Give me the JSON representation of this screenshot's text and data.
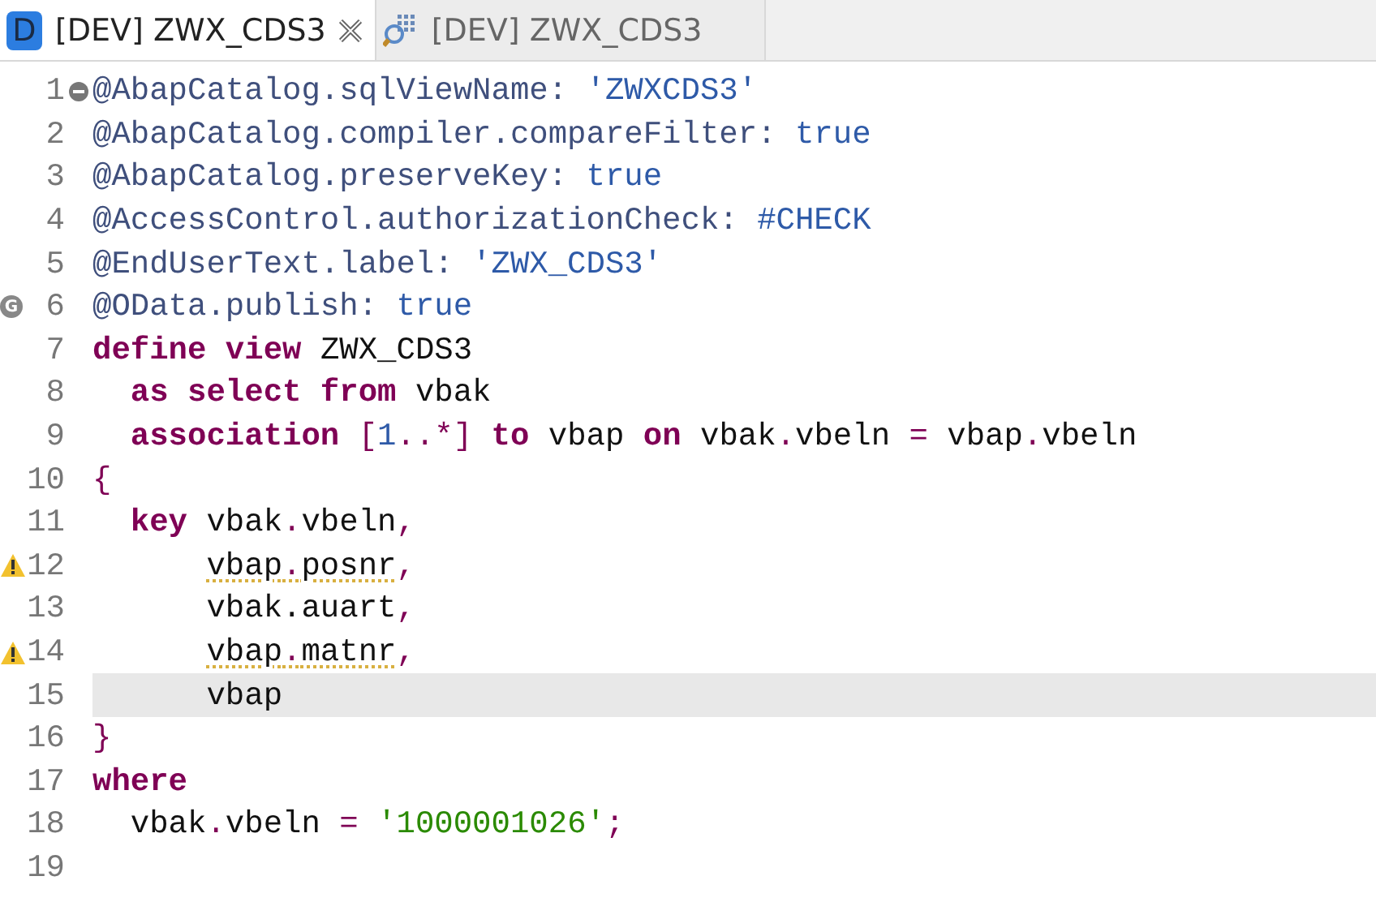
{
  "tabs": [
    {
      "label": "[DEV] ZWX_CDS3",
      "selected": true,
      "icon": {
        "kind": "letter",
        "text": "D"
      }
    },
    {
      "label": "[DEV] ZWX_CDS3",
      "selected": false,
      "icon": {
        "kind": "search"
      }
    }
  ],
  "lines": [
    {
      "number": "1",
      "marker": {
        "kind": "fold"
      },
      "tokens": [
        {
          "kind": "anno",
          "text": "@AbapCatalog.sqlViewName: "
        },
        {
          "kind": "string",
          "text": "'ZWXCDS3'"
        }
      ]
    },
    {
      "number": "2",
      "tokens": [
        {
          "kind": "anno",
          "text": "@AbapCatalog.compiler.compareFilter: "
        },
        {
          "kind": "string",
          "text": "true"
        }
      ]
    },
    {
      "number": "3",
      "tokens": [
        {
          "kind": "anno",
          "text": "@AbapCatalog.preserveKey: "
        },
        {
          "kind": "string",
          "text": "true"
        }
      ]
    },
    {
      "number": "4",
      "tokens": [
        {
          "kind": "anno",
          "text": "@AccessControl.authorizationCheck: "
        },
        {
          "kind": "string",
          "text": "#CHECK"
        }
      ]
    },
    {
      "number": "5",
      "tokens": [
        {
          "kind": "anno",
          "text": "@EndUserText.label: "
        },
        {
          "kind": "string",
          "text": "'ZWX_CDS3'"
        }
      ]
    },
    {
      "number": "6",
      "marker": {
        "kind": "generated",
        "text": "G"
      },
      "tokens": [
        {
          "kind": "anno",
          "text": "@OData.publish: "
        },
        {
          "kind": "string",
          "text": "true"
        }
      ]
    },
    {
      "number": "7",
      "tokens": [
        {
          "kind": "keyword",
          "text": "define view"
        },
        {
          "kind": "plain",
          "text": " ZWX_CDS3"
        }
      ]
    },
    {
      "number": "8",
      "tokens": [
        {
          "kind": "keyword",
          "text": "  as select from"
        },
        {
          "kind": "plain",
          "text": " vbak"
        }
      ]
    },
    {
      "number": "9",
      "tokens": [
        {
          "kind": "keyword",
          "text": "  association"
        },
        {
          "kind": "punct",
          "text": " ["
        },
        {
          "kind": "number",
          "text": "1"
        },
        {
          "kind": "punct",
          "text": "..*]"
        },
        {
          "kind": "keyword",
          "text": " to"
        },
        {
          "kind": "plain",
          "text": " vbap "
        },
        {
          "kind": "keyword",
          "text": "on"
        },
        {
          "kind": "plain",
          "text": " vbak"
        },
        {
          "kind": "punct",
          "text": "."
        },
        {
          "kind": "plain",
          "text": "vbeln "
        },
        {
          "kind": "punct",
          "text": "="
        },
        {
          "kind": "plain",
          "text": " vbap"
        },
        {
          "kind": "punct",
          "text": "."
        },
        {
          "kind": "plain",
          "text": "vbeln"
        }
      ]
    },
    {
      "number": "10",
      "tokens": [
        {
          "kind": "punct",
          "text": "{"
        }
      ]
    },
    {
      "number": "11",
      "tokens": [
        {
          "kind": "keyword",
          "text": "  key"
        },
        {
          "kind": "plain",
          "text": " vbak"
        },
        {
          "kind": "punct",
          "text": "."
        },
        {
          "kind": "plain",
          "text": "vbeln"
        },
        {
          "kind": "punct",
          "text": ","
        }
      ]
    },
    {
      "number": "12",
      "marker": {
        "kind": "warning"
      },
      "tokens": [
        {
          "kind": "plain",
          "text": "      vbap",
          "warn": true
        },
        {
          "kind": "punct",
          "text": ".",
          "warn": true
        },
        {
          "kind": "plain",
          "text": "posnr",
          "warn": true
        },
        {
          "kind": "punct",
          "text": ","
        }
      ]
    },
    {
      "number": "13",
      "tokens": [
        {
          "kind": "plain",
          "text": "      vbak.auart"
        },
        {
          "kind": "punct",
          "text": ","
        }
      ]
    },
    {
      "number": "14",
      "marker": {
        "kind": "warning"
      },
      "tokens": [
        {
          "kind": "plain",
          "text": "      vbap",
          "warn": true
        },
        {
          "kind": "punct",
          "text": ".",
          "warn": true
        },
        {
          "kind": "plain",
          "text": "matnr",
          "warn": true
        },
        {
          "kind": "punct",
          "text": ","
        }
      ]
    },
    {
      "number": "15",
      "current": true,
      "tokens": [
        {
          "kind": "plain",
          "text": "      vbap"
        }
      ]
    },
    {
      "number": "16",
      "tokens": [
        {
          "kind": "punct",
          "text": "}"
        }
      ]
    },
    {
      "number": "17",
      "tokens": [
        {
          "kind": "keyword",
          "text": "where"
        }
      ]
    },
    {
      "number": "18",
      "tokens": [
        {
          "kind": "plain",
          "text": "  vbak"
        },
        {
          "kind": "punct",
          "text": "."
        },
        {
          "kind": "plain",
          "text": "vbeln "
        },
        {
          "kind": "punct",
          "text": "= "
        },
        {
          "kind": "green",
          "text": "'1000001026'"
        },
        {
          "kind": "punct",
          "text": ";"
        }
      ]
    },
    {
      "number": "19"
    }
  ]
}
